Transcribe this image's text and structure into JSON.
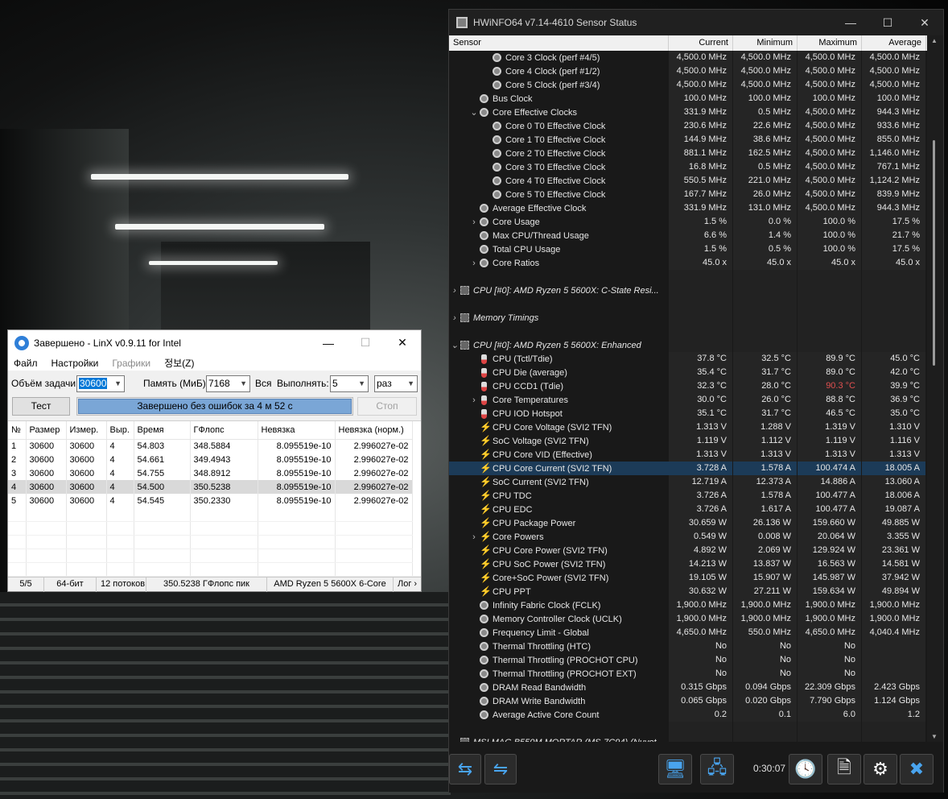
{
  "hwinfo": {
    "title": "HWiNFO64 v7.14-4610 Sensor Status",
    "columns": [
      "Sensor",
      "Current",
      "Minimum",
      "Maximum",
      "Average"
    ],
    "timer": "0:30:07",
    "rows": [
      {
        "indent": 2,
        "icon": "clock",
        "label": "Core 3 Clock (perf #4/5)",
        "cur": "4,500.0 MHz",
        "min": "4,500.0 MHz",
        "max": "4,500.0 MHz",
        "avg": "4,500.0 MHz"
      },
      {
        "indent": 2,
        "icon": "clock",
        "label": "Core 4 Clock (perf #1/2)",
        "cur": "4,500.0 MHz",
        "min": "4,500.0 MHz",
        "max": "4,500.0 MHz",
        "avg": "4,500.0 MHz"
      },
      {
        "indent": 2,
        "icon": "clock",
        "label": "Core 5 Clock (perf #3/4)",
        "cur": "4,500.0 MHz",
        "min": "4,500.0 MHz",
        "max": "4,500.0 MHz",
        "avg": "4,500.0 MHz"
      },
      {
        "indent": 1,
        "icon": "clock",
        "label": "Bus Clock",
        "cur": "100.0 MHz",
        "min": "100.0 MHz",
        "max": "100.0 MHz",
        "avg": "100.0 MHz"
      },
      {
        "indent": 1,
        "exp": "v",
        "icon": "clock",
        "label": "Core Effective Clocks",
        "cur": "331.9 MHz",
        "min": "0.5 MHz",
        "max": "4,500.0 MHz",
        "avg": "944.3 MHz"
      },
      {
        "indent": 2,
        "icon": "clock",
        "label": "Core 0 T0 Effective Clock",
        "cur": "230.6 MHz",
        "min": "22.6 MHz",
        "max": "4,500.0 MHz",
        "avg": "933.6 MHz"
      },
      {
        "indent": 2,
        "icon": "clock",
        "label": "Core 1 T0 Effective Clock",
        "cur": "144.9 MHz",
        "min": "38.6 MHz",
        "max": "4,500.0 MHz",
        "avg": "855.0 MHz"
      },
      {
        "indent": 2,
        "icon": "clock",
        "label": "Core 2 T0 Effective Clock",
        "cur": "881.1 MHz",
        "min": "162.5 MHz",
        "max": "4,500.0 MHz",
        "avg": "1,146.0 MHz"
      },
      {
        "indent": 2,
        "icon": "clock",
        "label": "Core 3 T0 Effective Clock",
        "cur": "16.8 MHz",
        "min": "0.5 MHz",
        "max": "4,500.0 MHz",
        "avg": "767.1 MHz"
      },
      {
        "indent": 2,
        "icon": "clock",
        "label": "Core 4 T0 Effective Clock",
        "cur": "550.5 MHz",
        "min": "221.0 MHz",
        "max": "4,500.0 MHz",
        "avg": "1,124.2 MHz"
      },
      {
        "indent": 2,
        "icon": "clock",
        "label": "Core 5 T0 Effective Clock",
        "cur": "167.7 MHz",
        "min": "26.0 MHz",
        "max": "4,500.0 MHz",
        "avg": "839.9 MHz"
      },
      {
        "indent": 1,
        "icon": "clock",
        "label": "Average Effective Clock",
        "cur": "331.9 MHz",
        "min": "131.0 MHz",
        "max": "4,500.0 MHz",
        "avg": "944.3 MHz"
      },
      {
        "indent": 1,
        "exp": ">",
        "icon": "clock",
        "label": "Core Usage",
        "cur": "1.5 %",
        "min": "0.0 %",
        "max": "100.0 %",
        "avg": "17.5 %"
      },
      {
        "indent": 1,
        "icon": "clock",
        "label": "Max CPU/Thread Usage",
        "cur": "6.6 %",
        "min": "1.4 %",
        "max": "100.0 %",
        "avg": "21.7 %"
      },
      {
        "indent": 1,
        "icon": "clock",
        "label": "Total CPU Usage",
        "cur": "1.5 %",
        "min": "0.5 %",
        "max": "100.0 %",
        "avg": "17.5 %"
      },
      {
        "indent": 1,
        "exp": ">",
        "icon": "clock",
        "label": "Core Ratios",
        "cur": "45.0 x",
        "min": "45.0 x",
        "max": "45.0 x",
        "avg": "45.0 x"
      },
      {
        "blank": true
      },
      {
        "indent": 0,
        "exp": ">",
        "icon": "chip",
        "group": true,
        "label": "CPU [#0]: AMD Ryzen 5 5600X: C-State Resi..."
      },
      {
        "blank": true
      },
      {
        "indent": 0,
        "exp": ">",
        "icon": "chip",
        "group": true,
        "label": "Memory Timings"
      },
      {
        "blank": true
      },
      {
        "indent": 0,
        "exp": "v",
        "icon": "chip",
        "group": true,
        "label": "CPU [#0]: AMD Ryzen 5 5600X: Enhanced"
      },
      {
        "indent": 1,
        "icon": "thermo",
        "label": "CPU (Tctl/Tdie)",
        "cur": "37.8 °C",
        "min": "32.5 °C",
        "max": "89.9 °C",
        "avg": "45.0 °C"
      },
      {
        "indent": 1,
        "icon": "thermo",
        "label": "CPU Die (average)",
        "cur": "35.4 °C",
        "min": "31.7 °C",
        "max": "89.0 °C",
        "avg": "42.0 °C"
      },
      {
        "indent": 1,
        "icon": "thermo",
        "label": "CPU CCD1 (Tdie)",
        "cur": "32.3 °C",
        "min": "28.0 °C",
        "max": "90.3 °C",
        "avg": "39.9 °C",
        "maxRed": true
      },
      {
        "indent": 1,
        "exp": ">",
        "icon": "thermo",
        "label": "Core Temperatures",
        "cur": "30.0 °C",
        "min": "26.0 °C",
        "max": "88.8 °C",
        "avg": "36.9 °C"
      },
      {
        "indent": 1,
        "icon": "thermo",
        "label": "CPU IOD Hotspot",
        "cur": "35.1 °C",
        "min": "31.7 °C",
        "max": "46.5 °C",
        "avg": "35.0 °C"
      },
      {
        "indent": 1,
        "icon": "bolt",
        "label": "CPU Core Voltage (SVI2 TFN)",
        "cur": "1.313 V",
        "min": "1.288 V",
        "max": "1.319 V",
        "avg": "1.310 V"
      },
      {
        "indent": 1,
        "icon": "bolt",
        "label": "SoC Voltage (SVI2 TFN)",
        "cur": "1.119 V",
        "min": "1.112 V",
        "max": "1.119 V",
        "avg": "1.116 V"
      },
      {
        "indent": 1,
        "icon": "bolt",
        "label": "CPU Core VID (Effective)",
        "cur": "1.313 V",
        "min": "1.313 V",
        "max": "1.313 V",
        "avg": "1.313 V"
      },
      {
        "indent": 1,
        "icon": "bolt",
        "label": "CPU Core Current (SVI2 TFN)",
        "cur": "3.728 A",
        "min": "1.578 A",
        "max": "100.474 A",
        "avg": "18.005 A",
        "selected": true
      },
      {
        "indent": 1,
        "icon": "bolt",
        "label": "SoC Current (SVI2 TFN)",
        "cur": "12.719 A",
        "min": "12.373 A",
        "max": "14.886 A",
        "avg": "13.060 A"
      },
      {
        "indent": 1,
        "icon": "bolt",
        "label": "CPU TDC",
        "cur": "3.726 A",
        "min": "1.578 A",
        "max": "100.477 A",
        "avg": "18.006 A"
      },
      {
        "indent": 1,
        "icon": "bolt",
        "label": "CPU EDC",
        "cur": "3.726 A",
        "min": "1.617 A",
        "max": "100.477 A",
        "avg": "19.087 A"
      },
      {
        "indent": 1,
        "icon": "bolt",
        "label": "CPU Package Power",
        "cur": "30.659 W",
        "min": "26.136 W",
        "max": "159.660 W",
        "avg": "49.885 W"
      },
      {
        "indent": 1,
        "exp": ">",
        "icon": "bolt",
        "label": "Core Powers",
        "cur": "0.549 W",
        "min": "0.008 W",
        "max": "20.064 W",
        "avg": "3.355 W"
      },
      {
        "indent": 1,
        "icon": "bolt",
        "label": "CPU Core Power (SVI2 TFN)",
        "cur": "4.892 W",
        "min": "2.069 W",
        "max": "129.924 W",
        "avg": "23.361 W"
      },
      {
        "indent": 1,
        "icon": "bolt",
        "label": "CPU SoC Power (SVI2 TFN)",
        "cur": "14.213 W",
        "min": "13.837 W",
        "max": "16.563 W",
        "avg": "14.581 W"
      },
      {
        "indent": 1,
        "icon": "bolt",
        "label": "Core+SoC Power (SVI2 TFN)",
        "cur": "19.105 W",
        "min": "15.907 W",
        "max": "145.987 W",
        "avg": "37.942 W"
      },
      {
        "indent": 1,
        "icon": "bolt",
        "label": "CPU PPT",
        "cur": "30.632 W",
        "min": "27.211 W",
        "max": "159.634 W",
        "avg": "49.894 W"
      },
      {
        "indent": 1,
        "icon": "clock",
        "label": "Infinity Fabric Clock (FCLK)",
        "cur": "1,900.0 MHz",
        "min": "1,900.0 MHz",
        "max": "1,900.0 MHz",
        "avg": "1,900.0 MHz"
      },
      {
        "indent": 1,
        "icon": "clock",
        "label": "Memory Controller Clock (UCLK)",
        "cur": "1,900.0 MHz",
        "min": "1,900.0 MHz",
        "max": "1,900.0 MHz",
        "avg": "1,900.0 MHz"
      },
      {
        "indent": 1,
        "icon": "clock",
        "label": "Frequency Limit - Global",
        "cur": "4,650.0 MHz",
        "min": "550.0 MHz",
        "max": "4,650.0 MHz",
        "avg": "4,040.4 MHz"
      },
      {
        "indent": 1,
        "icon": "clock",
        "label": "Thermal Throttling (HTC)",
        "cur": "No",
        "min": "No",
        "max": "No",
        "avg": ""
      },
      {
        "indent": 1,
        "icon": "clock",
        "label": "Thermal Throttling (PROCHOT CPU)",
        "cur": "No",
        "min": "No",
        "max": "No",
        "avg": ""
      },
      {
        "indent": 1,
        "icon": "clock",
        "label": "Thermal Throttling (PROCHOT EXT)",
        "cur": "No",
        "min": "No",
        "max": "No",
        "avg": ""
      },
      {
        "indent": 1,
        "icon": "clock",
        "label": "DRAM Read Bandwidth",
        "cur": "0.315 Gbps",
        "min": "0.094 Gbps",
        "max": "22.309 Gbps",
        "avg": "2.423 Gbps"
      },
      {
        "indent": 1,
        "icon": "clock",
        "label": "DRAM Write Bandwidth",
        "cur": "0.065 Gbps",
        "min": "0.020 Gbps",
        "max": "7.790 Gbps",
        "avg": "1.124 Gbps"
      },
      {
        "indent": 1,
        "icon": "clock",
        "label": "Average Active Core Count",
        "cur": "0.2",
        "min": "0.1",
        "max": "6.0",
        "avg": "1.2"
      },
      {
        "blank": true
      },
      {
        "indent": 0,
        "exp": "v",
        "icon": "chip",
        "group": true,
        "label": "MSI MAG B550M MORTAR (MS-7C94) (Nuvot..."
      }
    ]
  },
  "linx": {
    "title": "Завершено - LinX v0.9.11 for Intel",
    "menu": {
      "file": "Файл",
      "settings": "Настройки",
      "graphs": "Графики",
      "info": "정보(Z)"
    },
    "params": {
      "problem_size_label": "Объём задачи:",
      "problem_size": "30600",
      "memory_label": "Память (МиБ):",
      "memory": "7168",
      "all_label": "Вся",
      "run_label": "Выполнять:",
      "runs": "5",
      "times": "раз"
    },
    "test_button": "Тест",
    "stop_button": "Стоп",
    "progress_text": "Завершено без ошибок за 4 м 52 с",
    "progress": 1.0,
    "headers": [
      "№",
      "Размер",
      "Измер.",
      "Выр.",
      "Время",
      "ГФлопс",
      "Невязка",
      "Невязка (норм.)"
    ],
    "results": [
      [
        "1",
        "30600",
        "30600",
        "4",
        "54.803",
        "348.5884",
        "8.095519e-10",
        "2.996027e-02"
      ],
      [
        "2",
        "30600",
        "30600",
        "4",
        "54.661",
        "349.4943",
        "8.095519e-10",
        "2.996027e-02"
      ],
      [
        "3",
        "30600",
        "30600",
        "4",
        "54.755",
        "348.8912",
        "8.095519e-10",
        "2.996027e-02"
      ],
      [
        "4",
        "30600",
        "30600",
        "4",
        "54.500",
        "350.5238",
        "8.095519e-10",
        "2.996027e-02"
      ],
      [
        "5",
        "30600",
        "30600",
        "4",
        "54.545",
        "350.2330",
        "8.095519e-10",
        "2.996027e-02"
      ]
    ],
    "status": {
      "runs": "5/5",
      "bits": "64-бит",
      "threads": "12 потоков",
      "peak": "350.5238 ГФлопс пик",
      "cpu": "AMD Ryzen 5 5600X 6-Core",
      "log": "Лог"
    }
  }
}
